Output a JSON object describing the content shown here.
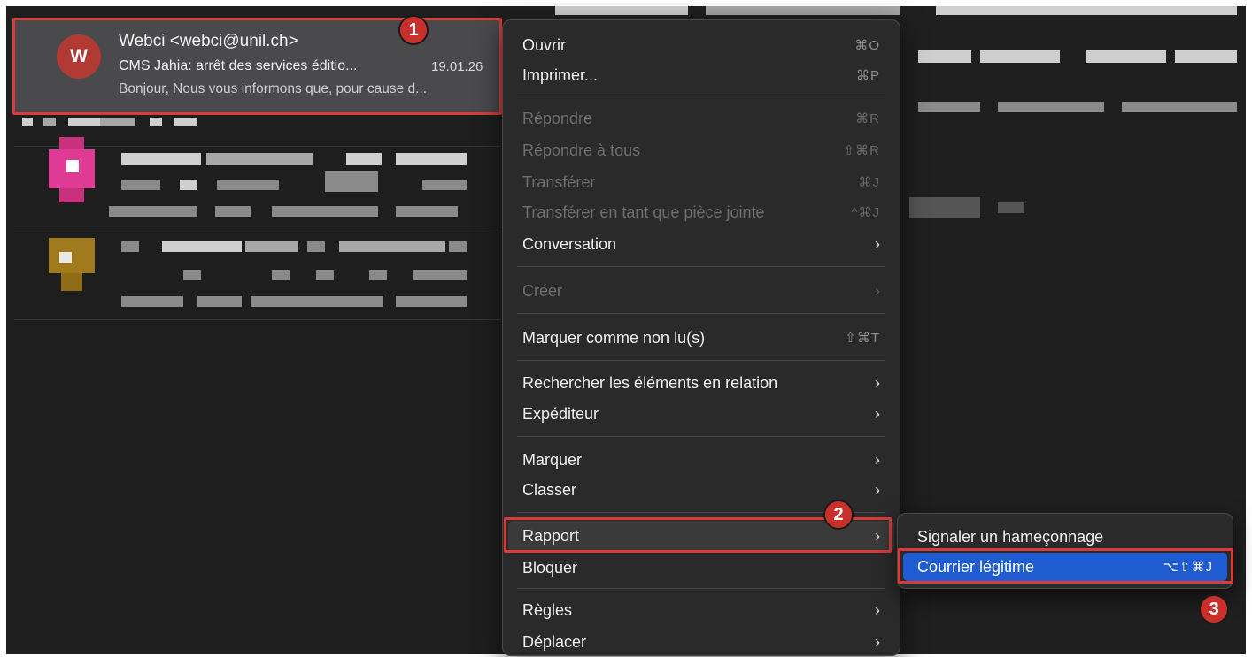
{
  "selected_message": {
    "avatar_letter": "W",
    "sender": "Webci <webci@unil.ch>",
    "subject": "CMS Jahia: arrêt des services éditio...",
    "date": "19.01.26",
    "preview": "Bonjour, Nous vous informons que, pour cause d..."
  },
  "badges": {
    "one": "1",
    "two": "2",
    "three": "3"
  },
  "menu": {
    "items": [
      {
        "label": "Ouvrir",
        "shortcut": "⌘O",
        "enabled": true
      },
      {
        "label": "Imprimer...",
        "shortcut": "⌘P",
        "enabled": true
      },
      {
        "label": "Répondre",
        "shortcut": "⌘R",
        "enabled": false
      },
      {
        "label": "Répondre à tous",
        "shortcut": "⇧⌘R",
        "enabled": false
      },
      {
        "label": "Transférer",
        "shortcut": "⌘J",
        "enabled": false
      },
      {
        "label": "Transférer en tant que pièce jointe",
        "shortcut": "^⌘J",
        "enabled": false
      },
      {
        "label": "Conversation",
        "submenu": true,
        "enabled": true
      },
      {
        "label": "Créer",
        "submenu": true,
        "enabled": false
      },
      {
        "label": "Marquer comme non lu(s)",
        "shortcut": "⇧⌘T",
        "enabled": true
      },
      {
        "label": "Rechercher les éléments en relation",
        "submenu": true,
        "enabled": true
      },
      {
        "label": "Expéditeur",
        "submenu": true,
        "enabled": true
      },
      {
        "label": "Marquer",
        "submenu": true,
        "enabled": true
      },
      {
        "label": "Classer",
        "submenu": true,
        "enabled": true
      },
      {
        "label": "Rapport",
        "submenu": true,
        "enabled": true,
        "highlighted": true
      },
      {
        "label": "Bloquer",
        "enabled": true
      },
      {
        "label": "Règles",
        "submenu": true,
        "enabled": true
      },
      {
        "label": "Déplacer",
        "submenu": true,
        "enabled": true
      }
    ],
    "chevron": "›"
  },
  "submenu": {
    "items": [
      {
        "label": "Signaler un hameçonnage"
      },
      {
        "label": "Courrier légitime",
        "shortcut": "⌥⇧⌘J",
        "active": true
      }
    ]
  },
  "colors": {
    "accent_blue": "#1f5bd1",
    "annotation_red": "#d93b3b",
    "avatar_red": "#b23a34"
  }
}
